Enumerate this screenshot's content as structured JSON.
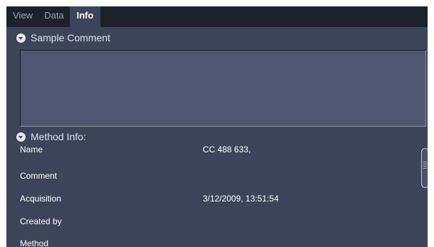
{
  "tabs": [
    {
      "label": "View",
      "active": false
    },
    {
      "label": "Data",
      "active": false
    },
    {
      "label": "Info",
      "active": true
    }
  ],
  "sample_comment": {
    "header": "Sample Comment",
    "value": ""
  },
  "method_info": {
    "header": "Method Info:",
    "rows": [
      {
        "label": "Name",
        "value": "CC 488 633,"
      },
      {
        "label": "Comment",
        "value": ""
      },
      {
        "label": "Acquisition",
        "value": "3/12/2009, 13:51:54"
      },
      {
        "label": "Created by",
        "value": ""
      },
      {
        "label": "Method",
        "value": ""
      }
    ]
  },
  "colors": {
    "panel_bg": "#3c4459",
    "tabbar_bg": "#1c212b",
    "field_bg": "#4f5770",
    "text": "#ffffff"
  },
  "icons": {
    "section_toggle": "collapse-arrow-icon",
    "scroll_grip": "scrollbar-grip-icon"
  }
}
